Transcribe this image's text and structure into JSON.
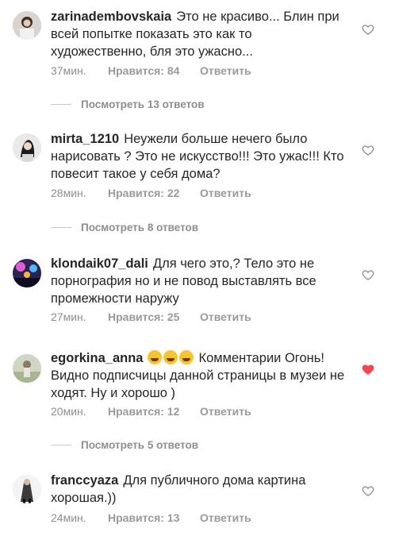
{
  "comments": [
    {
      "username": "zarinadembovskaia",
      "text": "Это не красиво... Блин при всей попытке показать это как то художественно, бля это ужасно...",
      "time": "37мин.",
      "likes": "Нравится: 84",
      "reply": "Ответить",
      "liked": false
    },
    {
      "username": "mirta_1210",
      "text": "Неужели больше нечего было нарисовать ? Это не искусство!!! Это ужас!!! Кто повесит такое у себя дома?",
      "time": "28мин.",
      "likes": "Нравится: 22",
      "reply": "Ответить",
      "liked": false
    },
    {
      "username": "klondaik07_dali",
      "text": "Для чего это,? Тело это не порнография но и не повод выставлять все промежности наружу",
      "time": "27мин.",
      "likes": "Нравится: 25",
      "reply": "Ответить",
      "liked": false
    },
    {
      "username": "egorkina_anna",
      "text": "Комментарии Огонь! Видно подписчицы данной страницы в музеи не ходят. Ну и хорошо )",
      "time": "20мин.",
      "likes": "Нравится: 12",
      "reply": "Ответить",
      "liked": true
    },
    {
      "username": "franccyaza",
      "text": "Для публичного дома картина хорошая.))",
      "time": "24мин.",
      "likes": "Нравится: 13",
      "reply": "Ответить",
      "liked": false
    }
  ],
  "view_replies": [
    "Посмотреть 13 ответов",
    "Посмотреть 8 ответов",
    "Посмотреть 5 ответов"
  ],
  "colors": {
    "text": "#262626",
    "meta": "#8e8e8e",
    "heart_liked": "#ed4956",
    "heart_outline": "#8e8e8e"
  }
}
